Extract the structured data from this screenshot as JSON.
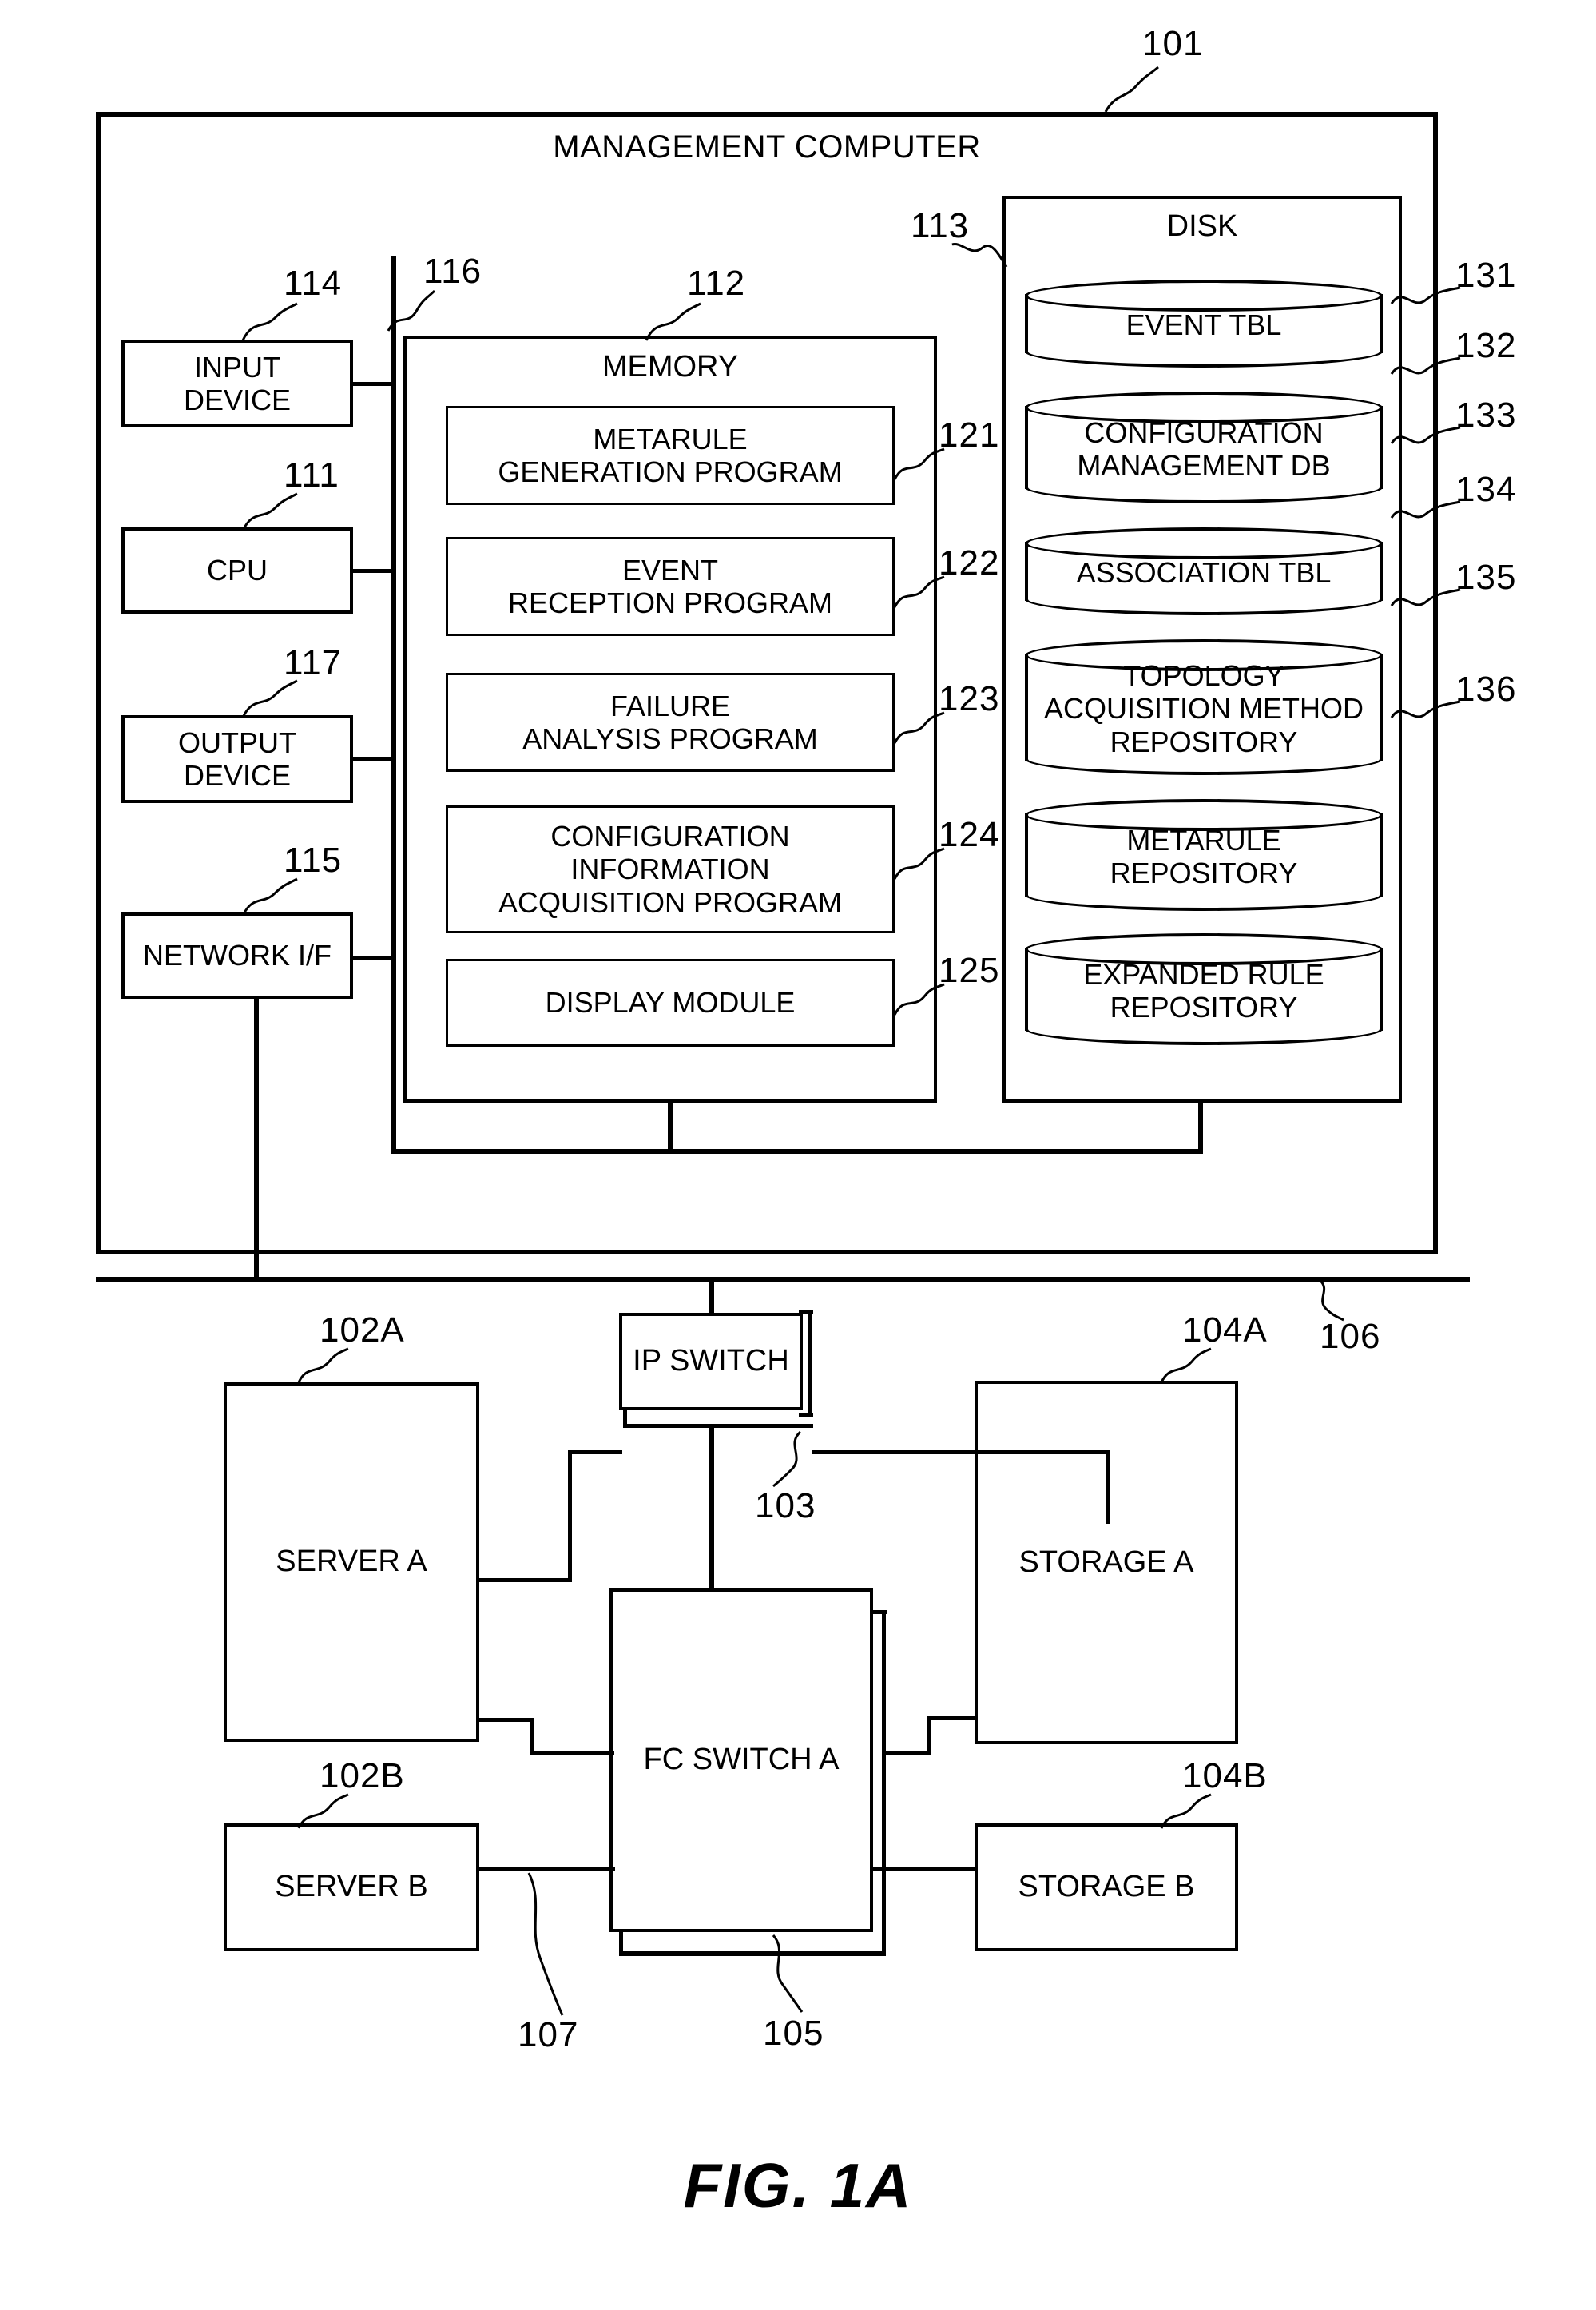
{
  "figure": {
    "caption": "FIG. 1A",
    "top_ref": "101"
  },
  "management_computer": {
    "title": "MANAGEMENT COMPUTER",
    "ref": "101",
    "bus_ref": "116"
  },
  "left_devices": [
    {
      "label_line1": "INPUT",
      "label_line2": "DEVICE",
      "ref": "114"
    },
    {
      "label_line1": "CPU",
      "label_line2": "",
      "ref": "111"
    },
    {
      "label_line1": "OUTPUT",
      "label_line2": "DEVICE",
      "ref": "117"
    },
    {
      "label_line1": "NETWORK I/F",
      "label_line2": "",
      "ref": "115"
    }
  ],
  "memory": {
    "title": "MEMORY",
    "ref": "112",
    "items": [
      {
        "line1": "METARULE",
        "line2": "GENERATION PROGRAM",
        "line3": "",
        "ref": "121"
      },
      {
        "line1": "EVENT",
        "line2": "RECEPTION PROGRAM",
        "line3": "",
        "ref": "122"
      },
      {
        "line1": "FAILURE",
        "line2": "ANALYSIS PROGRAM",
        "line3": "",
        "ref": "123"
      },
      {
        "line1": "CONFIGURATION",
        "line2": "INFORMATION",
        "line3": "ACQUISITION PROGRAM",
        "ref": "124"
      },
      {
        "line1": "DISPLAY MODULE",
        "line2": "",
        "line3": "",
        "ref": "125"
      }
    ]
  },
  "disk": {
    "title": "DISK",
    "ref": "113",
    "items": [
      {
        "line1": "EVENT TBL",
        "line2": "",
        "line3": "",
        "ref": "131"
      },
      {
        "line1": "CONFIGURATION",
        "line2": "MANAGEMENT DB",
        "line3": "",
        "ref": "132"
      },
      {
        "line1": "ASSOCIATION TBL",
        "line2": "",
        "line3": "",
        "ref": "133"
      },
      {
        "line1": "TOPOLOGY",
        "line2": "ACQUISITION METHOD",
        "line3": "REPOSITORY",
        "ref": "134"
      },
      {
        "line1": "METARULE",
        "line2": "REPOSITORY",
        "line3": "",
        "ref": "135"
      },
      {
        "line1": "EXPANDED RULE",
        "line2": "REPOSITORY",
        "line3": "",
        "ref": "136"
      }
    ]
  },
  "network": {
    "ip_network_ref": "106",
    "nodes": [
      {
        "label": "IP SWITCH",
        "ref": "103"
      },
      {
        "label": "SERVER A",
        "ref": "102A"
      },
      {
        "label": "SERVER B",
        "ref": "102B"
      },
      {
        "label": "STORAGE A",
        "ref": "104A"
      },
      {
        "label": "STORAGE B",
        "ref": "104B"
      },
      {
        "label": "FC SWITCH A",
        "ref": "105"
      }
    ],
    "fc_link_ref": "107"
  }
}
